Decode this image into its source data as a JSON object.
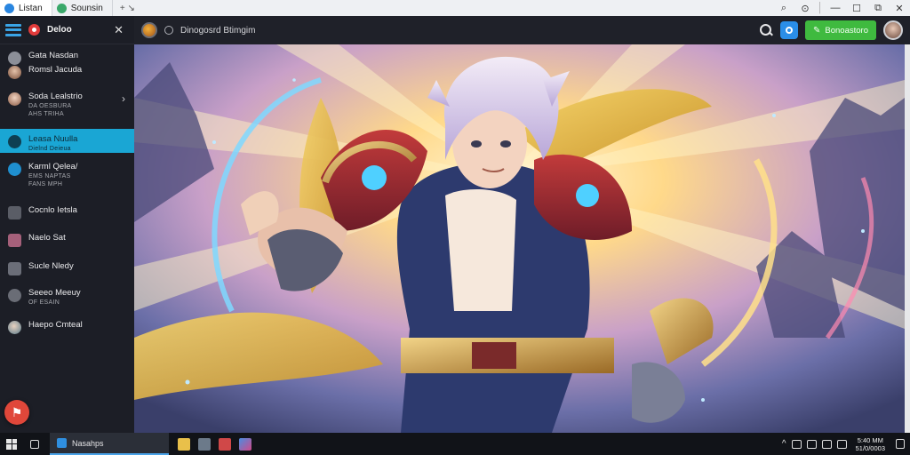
{
  "browser": {
    "tabs": [
      {
        "label": "Listan",
        "icon": "app-tab-icon"
      },
      {
        "label": "Sounsin",
        "icon": "sound-tab-icon"
      }
    ],
    "new_tab": "+ ↘",
    "controls": [
      "⌕",
      "⊙",
      "│",
      "—",
      "☐",
      "⧉",
      "✕"
    ]
  },
  "sidebar": {
    "title": "Deloo",
    "close": "✕",
    "items": [
      {
        "label": "Gata  Nasdan",
        "sub": "",
        "icon": "map-icon"
      },
      {
        "label": "Romsl  Jacuda",
        "sub": "",
        "icon": "user-icon"
      },
      {
        "label": "Soda  Lealstrio",
        "sub": "DA OESBURA\nAHS TRIHA",
        "icon": "profile-icon",
        "chevron": "›"
      },
      {
        "label": "Leasa  Nuulla",
        "sub": "Dielnd  Deieua",
        "icon": "drop-icon",
        "active": true
      },
      {
        "label": "Karml  Qelea/",
        "sub": "EMS NAPTAS\nFANS MPH",
        "icon": "chat-icon"
      },
      {
        "label": "Cocnlo  Ietsla",
        "sub": "",
        "icon": "mail-icon"
      },
      {
        "label": "Naelo  Sat",
        "sub": "",
        "icon": "calendar-icon"
      },
      {
        "label": "Sucle  Nledy",
        "sub": "",
        "icon": "grid-icon"
      },
      {
        "label": "Seeeo  Meeuy",
        "sub": "OF ESAIN",
        "icon": "tag-icon"
      },
      {
        "label": "Haepo  Cmteal",
        "sub": "",
        "icon": "globe-icon"
      }
    ],
    "fab_icon": "⚑"
  },
  "appbar": {
    "title": "Dinogosrd  Btimgim",
    "cta_label": "Bonoastoro",
    "cta_icon": "✎"
  },
  "taskbar": {
    "app_label": "Nasahps",
    "clock_time": "5:40 MM",
    "clock_date": "51/0/0003"
  },
  "colors": {
    "accent": "#1aa6d4",
    "cta": "#3fba3f",
    "fab": "#e0473a"
  }
}
